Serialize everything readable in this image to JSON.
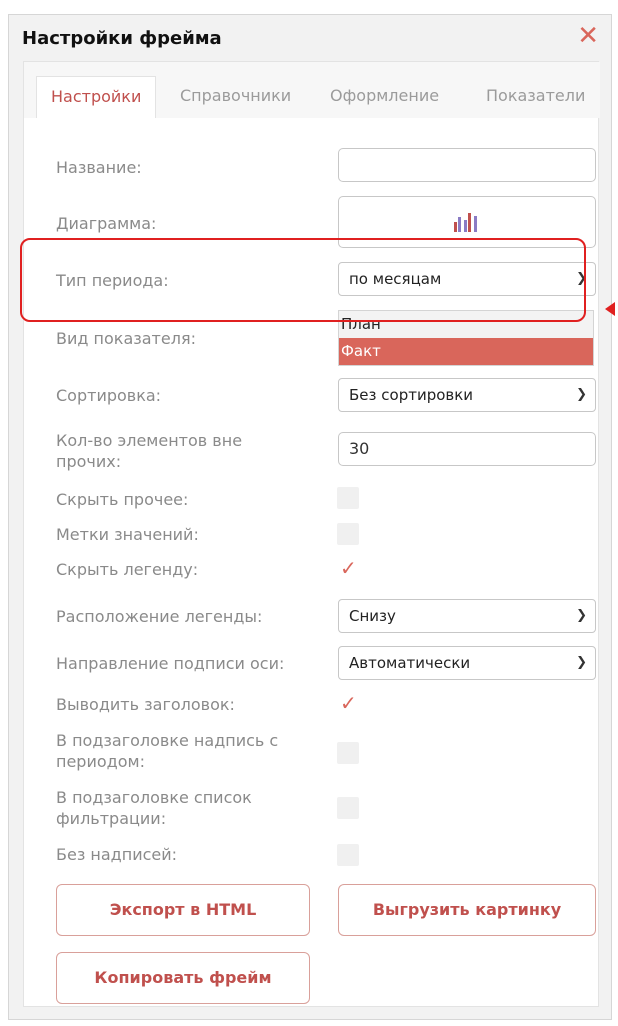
{
  "dialog": {
    "title": "Настройки фрейма",
    "close_icon": "close-icon"
  },
  "tabs": [
    {
      "label": "Настройки",
      "active": true
    },
    {
      "label": "Справочники",
      "active": false
    },
    {
      "label": "Оформление",
      "active": false
    },
    {
      "label": "Показатели",
      "active": false
    }
  ],
  "fields": {
    "name": {
      "label": "Название:",
      "value": ""
    },
    "chart": {
      "label": "Диаграмма:",
      "icon": "bar-chart-icon"
    },
    "period_type": {
      "label": "Тип периода:",
      "value": "по месяцам"
    },
    "indicator_type": {
      "label": "Вид показателя:",
      "options": [
        "План",
        "Факт"
      ],
      "selected": "Факт"
    },
    "sorting": {
      "label": "Сортировка:",
      "value": "Без сортировки"
    },
    "elements_count": {
      "label": "Кол-во элементов вне прочих:",
      "value": "30"
    },
    "hide_other": {
      "label": "Скрыть прочее:",
      "checked": false
    },
    "value_labels": {
      "label": "Метки значений:",
      "checked": false
    },
    "hide_legend": {
      "label": "Скрыть легенду:",
      "checked": true
    },
    "legend_position": {
      "label": "Расположение легенды:",
      "value": "Снизу"
    },
    "axis_label_direction": {
      "label": "Направление подписи оси:",
      "value": "Автоматически"
    },
    "show_title": {
      "label": "Выводить заголовок:",
      "checked": true
    },
    "subtitle_period": {
      "label": "В подзаголовке надпись с периодом:",
      "checked": false
    },
    "subtitle_filter": {
      "label": "В подзаголовке список фильтрации:",
      "checked": false
    },
    "no_labels": {
      "label": "Без надписей:",
      "checked": false
    }
  },
  "buttons": {
    "export_html": "Экспорт в HTML",
    "export_image": "Выгрузить картинку",
    "copy_frame": "Копировать фрейм"
  },
  "colors": {
    "accent": "#d9665b",
    "highlight": "#e02020"
  }
}
